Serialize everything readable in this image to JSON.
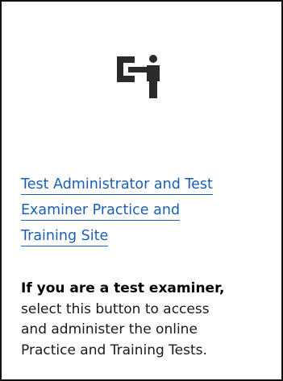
{
  "card": {
    "icon": "presenter-whiteboard-icon",
    "link_lines": [
      "Test Administrator and Test",
      "Examiner Practice and",
      "Training Site"
    ],
    "description": {
      "lead": "If you are a test examiner,",
      "lines": [
        "select this button to access",
        "and administer the online",
        "Practice and Training Tests."
      ]
    }
  },
  "colors": {
    "link": "#1a5fb4",
    "icon": "#2b2b2b",
    "border": "#111111"
  }
}
